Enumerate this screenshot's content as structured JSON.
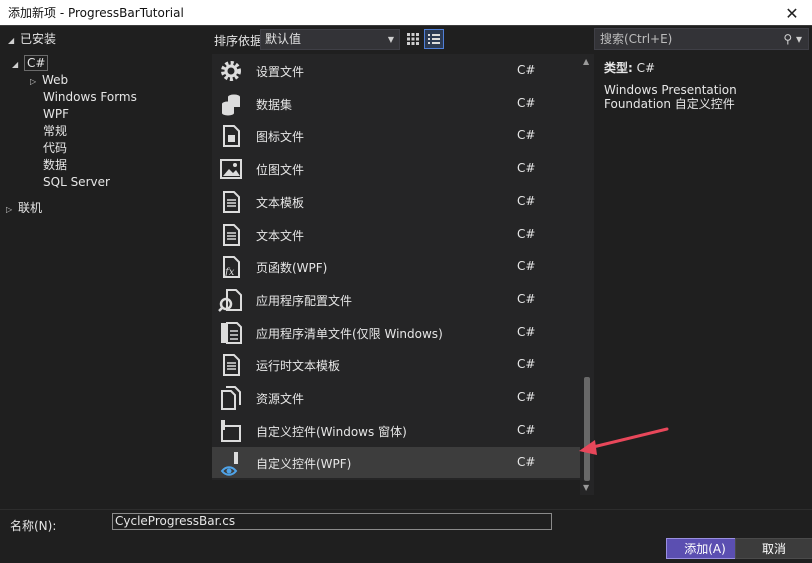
{
  "window": {
    "title": "添加新项 - ProgressBarTutorial",
    "close_icon": "close-icon"
  },
  "tree": {
    "installed": "已安装",
    "csharp": "C#",
    "children": [
      "Web",
      "Windows Forms",
      "WPF",
      "常规",
      "代码",
      "数据",
      "SQL Server"
    ],
    "online": "联机"
  },
  "toolbar": {
    "sort_label": "排序依据:",
    "sort_value": "默认值"
  },
  "search": {
    "placeholder": "搜索(Ctrl+E)"
  },
  "items": [
    {
      "name": "设置文件",
      "lang": "C#",
      "icon": "gear-icon"
    },
    {
      "name": "数据集",
      "lang": "C#",
      "icon": "dataset-icon"
    },
    {
      "name": "图标文件",
      "lang": "C#",
      "icon": "icon-file-icon"
    },
    {
      "name": "位图文件",
      "lang": "C#",
      "icon": "bitmap-icon"
    },
    {
      "name": "文本模板",
      "lang": "C#",
      "icon": "text-template-icon"
    },
    {
      "name": "文本文件",
      "lang": "C#",
      "icon": "text-file-icon"
    },
    {
      "name": "页函数(WPF)",
      "lang": "C#",
      "icon": "function-icon"
    },
    {
      "name": "应用程序配置文件",
      "lang": "C#",
      "icon": "config-icon"
    },
    {
      "name": "应用程序清单文件(仅限 Windows)",
      "lang": "C#",
      "icon": "manifest-icon"
    },
    {
      "name": "运行时文本模板",
      "lang": "C#",
      "icon": "runtime-template-icon"
    },
    {
      "name": "资源文件",
      "lang": "C#",
      "icon": "resource-icon"
    },
    {
      "name": "自定义控件(Windows 窗体)",
      "lang": "C#",
      "icon": "custom-control-forms-icon"
    },
    {
      "name": "自定义控件(WPF)",
      "lang": "C#",
      "icon": "custom-control-wpf-icon"
    }
  ],
  "detail": {
    "type_label": "类型:",
    "type_value": "C#",
    "description": "Windows Presentation Foundation 自定义控件"
  },
  "bottom": {
    "name_label": "名称(N):",
    "name_value": "CycleProgressBar.cs",
    "add_button": "添加(A)",
    "cancel_button": "取消"
  },
  "colors": {
    "accent": "#5b4fb1",
    "annotation_arrow": "#e8475a"
  }
}
